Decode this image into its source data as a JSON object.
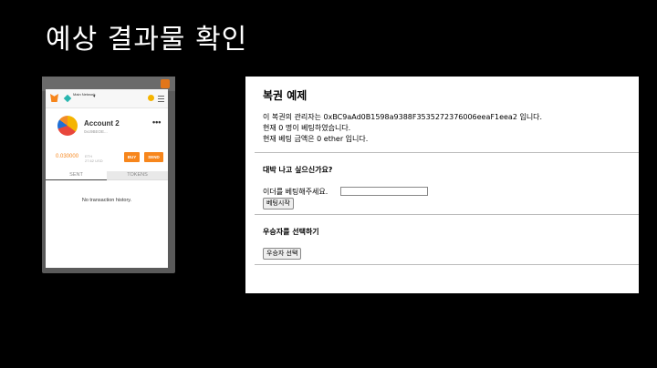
{
  "slide": {
    "title": "예상 결과물 확인"
  },
  "metamask": {
    "network_label": "Main Network",
    "account_name": "Account 2",
    "account_address": "0xc9BEOE...",
    "menu_dots": "•••",
    "balance": "0.030000",
    "balance_unit_eth": "ETH",
    "balance_usd": "27.62",
    "balance_unit_usd": "USD",
    "buy_label": "BUY",
    "send_label": "SEND",
    "tabs": [
      "SENT",
      "TOKENS"
    ],
    "empty_history": "No transaction history.",
    "colors": {
      "accent": "#f7861c",
      "network": "#29b6af"
    }
  },
  "dapp": {
    "title": "복권 예제",
    "manager_line": "이 복권의 관리자는 0xBC9aAd0B1598a9388F3535272376006eeaF1eea2 입니다.",
    "players_line": "현재 0 명이 베팅하였습니다.",
    "pot_line": "현재 베팅 금액은 0 ether 입니다.",
    "section_bet": "대박 나고 싶으신가요?",
    "bet_prompt": "이더를 베팅해주세요.",
    "bet_input_value": "",
    "bet_button": "베팅시작",
    "section_winner": "우승자를 선택하기",
    "winner_button": "우승자 선택"
  }
}
